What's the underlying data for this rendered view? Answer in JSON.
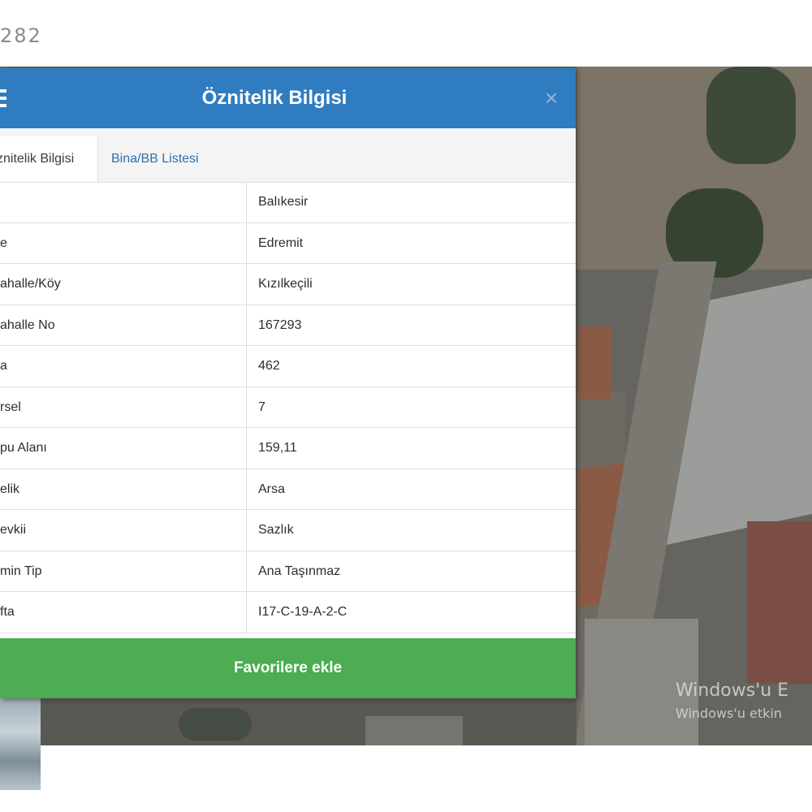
{
  "page": {
    "top_code": "282"
  },
  "dialog": {
    "title": "Öznitelik Bilgisi",
    "close_symbol": "×",
    "tabs": [
      {
        "label": "znitelik Bilgisi",
        "active": true
      },
      {
        "label": "Bina/BB Listesi",
        "active": false
      }
    ],
    "rows": [
      {
        "label": "",
        "value": "Balıkesir"
      },
      {
        "label": "e",
        "value": "Edremit"
      },
      {
        "label": "ahalle/Köy",
        "value": "Kızılkeçili"
      },
      {
        "label": "ahalle No",
        "value": "167293"
      },
      {
        "label": "a",
        "value": "462"
      },
      {
        "label": "rsel",
        "value": "7"
      },
      {
        "label": "pu Alanı",
        "value": "159,11"
      },
      {
        "label": "elik",
        "value": "Arsa"
      },
      {
        "label": "evkii",
        "value": "Sazlık"
      },
      {
        "label": "min Tip",
        "value": "Ana Taşınmaz"
      },
      {
        "label": "fta",
        "value": "I17-C-19-A-2-C"
      }
    ],
    "favorite_button": "Favorilere ekle"
  },
  "watermark": {
    "line1": "Windows'u E",
    "line2": "Windows'u etkin"
  },
  "colors": {
    "header_blue": "#2f7dc0",
    "button_green": "#4cad52",
    "tab_link_blue": "#2f6fb0"
  },
  "icons": [
    "menu-icon",
    "close-icon"
  ]
}
